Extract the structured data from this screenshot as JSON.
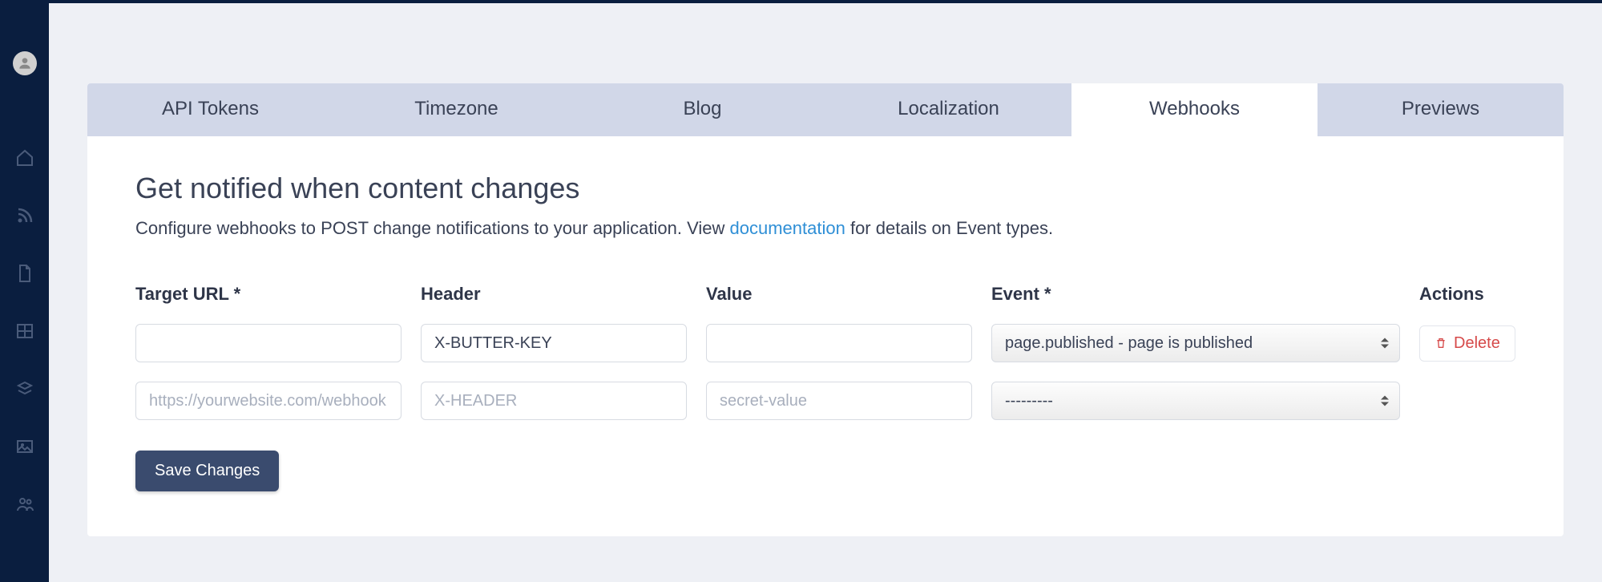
{
  "sidebar": {
    "icons": [
      "home-icon",
      "rss-icon",
      "page-icon",
      "grid-icon",
      "components-icon",
      "media-icon",
      "users-icon"
    ]
  },
  "tabs": [
    {
      "label": "API Tokens",
      "active": false
    },
    {
      "label": "Timezone",
      "active": false
    },
    {
      "label": "Blog",
      "active": false
    },
    {
      "label": "Localization",
      "active": false
    },
    {
      "label": "Webhooks",
      "active": true
    },
    {
      "label": "Previews",
      "active": false
    }
  ],
  "page": {
    "heading": "Get notified when content changes",
    "subtext_pre": "Configure webhooks to POST change notifications to your application. View ",
    "subtext_link": "documentation",
    "subtext_post": " for details on Event types."
  },
  "columns": {
    "target_url": "Target URL *",
    "header": "Header",
    "value": "Value",
    "event": "Event *",
    "actions": "Actions"
  },
  "rows": [
    {
      "target_url": "",
      "header": "X-BUTTER-KEY",
      "value": "",
      "event": "page.published - page is published",
      "delete_label": "Delete"
    },
    {
      "target_url_placeholder": "https://yourwebsite.com/webhook",
      "header_placeholder": "X-HEADER",
      "value_placeholder": "secret-value",
      "event": "---------"
    }
  ],
  "buttons": {
    "save": "Save Changes"
  }
}
